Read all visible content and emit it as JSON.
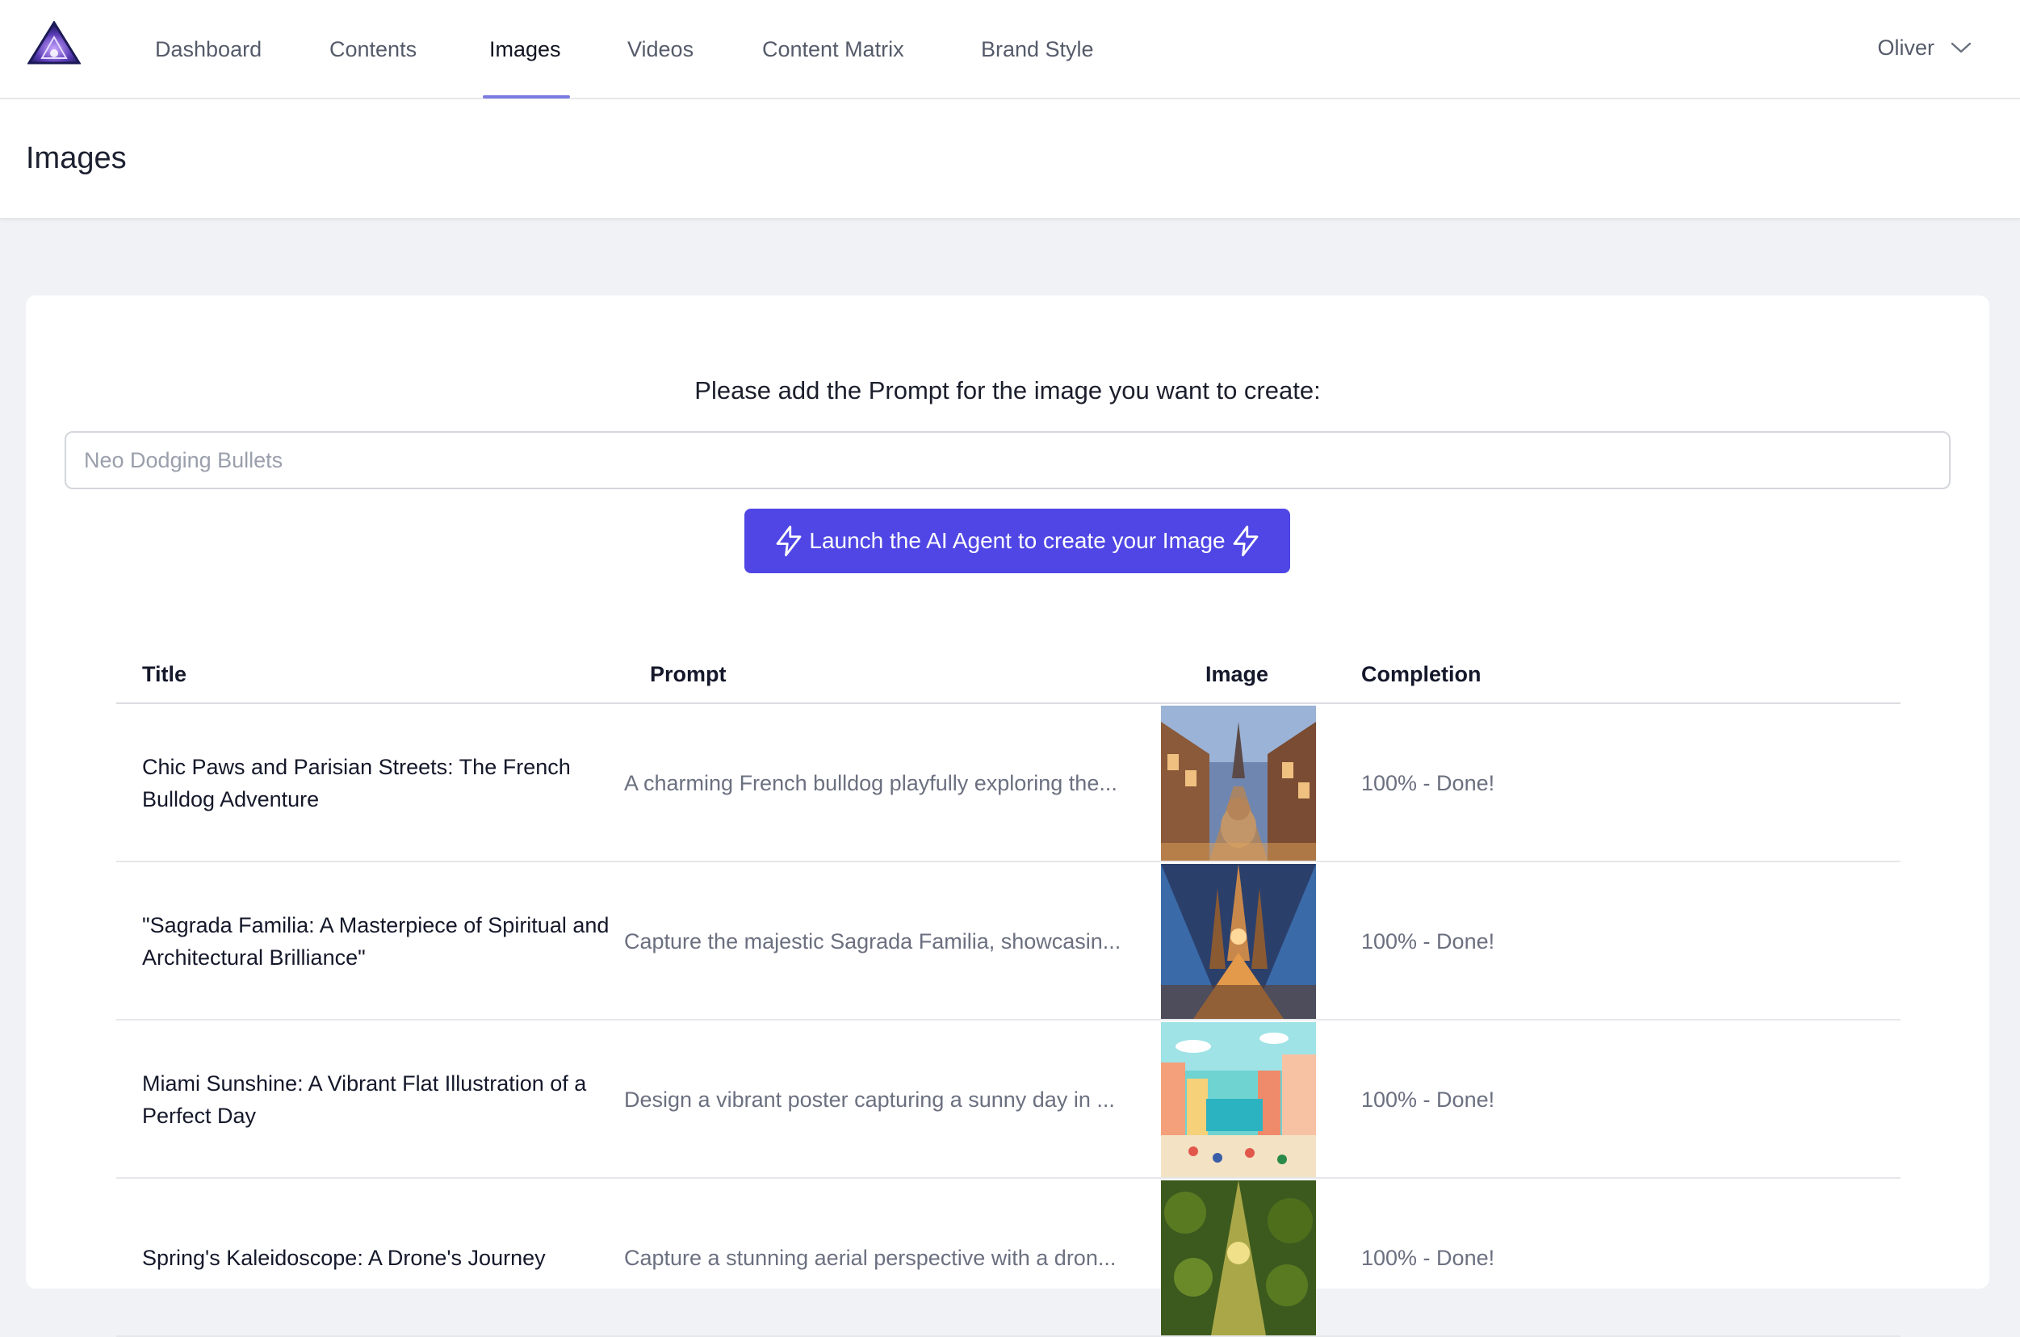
{
  "nav": {
    "items": [
      {
        "label": "Dashboard",
        "active": false
      },
      {
        "label": "Contents",
        "active": false
      },
      {
        "label": "Images",
        "active": true
      },
      {
        "label": "Videos",
        "active": false
      },
      {
        "label": "Content Matrix",
        "active": false
      },
      {
        "label": "Brand Style",
        "active": false
      }
    ],
    "user_name": "Oliver",
    "accent_color": "#7b7ce0"
  },
  "page": {
    "title": "Images"
  },
  "generator": {
    "label": "Please add the Prompt for the image you want to create:",
    "input_placeholder": "Neo Dodging Bullets",
    "input_value": "",
    "button_label": "Launch the AI Agent to create your Image",
    "button_color": "#4f46e5"
  },
  "table": {
    "columns": [
      "Title",
      "Prompt",
      "Image",
      "Completion"
    ],
    "rows": [
      {
        "title": "Chic Paws and Parisian Streets: The French Bulldog Adventure",
        "prompt": "A charming French bulldog playfully exploring the...",
        "image_icon": "paris-street-bulldog-thumbnail",
        "completion": "100% - Done!"
      },
      {
        "title": "\"Sagrada Familia: A Masterpiece of Spiritual and Architectural Brilliance\"",
        "prompt": "Capture the majestic Sagrada Familia, showcasin...",
        "image_icon": "sagrada-familia-thumbnail",
        "completion": "100% - Done!"
      },
      {
        "title": "Miami Sunshine: A Vibrant Flat Illustration of a Perfect Day",
        "prompt": "Design a vibrant poster capturing a sunny day in ...",
        "image_icon": "miami-poster-thumbnail",
        "completion": "100% - Done!"
      },
      {
        "title": "Spring's Kaleidoscope: A Drone's Journey",
        "prompt": "Capture a stunning aerial perspective with a dron...",
        "image_icon": "aerial-forest-thumbnail",
        "completion": "100% - Done!"
      }
    ]
  }
}
